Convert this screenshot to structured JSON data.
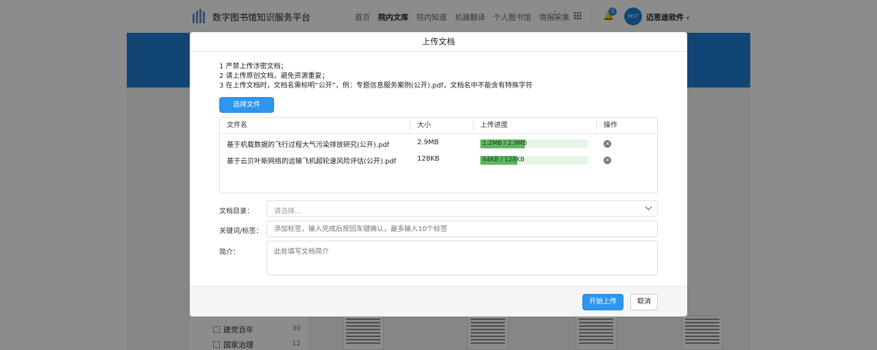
{
  "header": {
    "site_title": "数字图书馆知识服务平台",
    "nav": [
      "首页",
      "院内文库",
      "院内知道",
      "机器翻译",
      "个人图书馆",
      "情报采集"
    ],
    "active_nav": "院内文库",
    "notification_count": "3",
    "avatar_text": "MST",
    "user_name": "迈思途软件"
  },
  "sidebar": {
    "items": [
      {
        "label": "建党百年",
        "count": "30"
      },
      {
        "label": "国家治理",
        "count": "12"
      }
    ]
  },
  "modal": {
    "title": "上传文档",
    "notes": [
      "1  严禁上传涉密文档；",
      "2  请上传原创文档，避免资源重复；",
      "3  在上传文档时，文档名需标明“公开”，例：专题信息服务案例(公开).pdf，文档名中不能含有特殊字符"
    ],
    "choose_file_label": "选择文件",
    "table": {
      "columns": [
        "文件名",
        "大小",
        "上传进度",
        "操作"
      ],
      "rows": [
        {
          "name": "基于机载数据的飞行过程大气污染排放研究(公开).pdf",
          "size": "2.9MB",
          "progress_text": "1.2MB / 2.9MB",
          "progress": 0.41
        },
        {
          "name": "基于云贝叶斯网络的运输飞机超轮速风险评估(公开).pdf",
          "size": "128KB",
          "progress_text": "44KB / 128KB",
          "progress": 0.34
        }
      ]
    },
    "form": {
      "catalog_label": "文档目录：",
      "catalog_placeholder": "请选择…",
      "keywords_label": "关键词/标签：",
      "keywords_placeholder": "添加标签，输入完成后按回车键确认，最多输入10个标签",
      "intro_label": "简介：",
      "intro_placeholder": "此处填写文档简介"
    },
    "start_upload_label": "开始上传",
    "cancel_label": "取消"
  },
  "colors": {
    "accent": "#2e95f0",
    "banner": "#1f7fd4",
    "progress": "#5cb85c"
  }
}
